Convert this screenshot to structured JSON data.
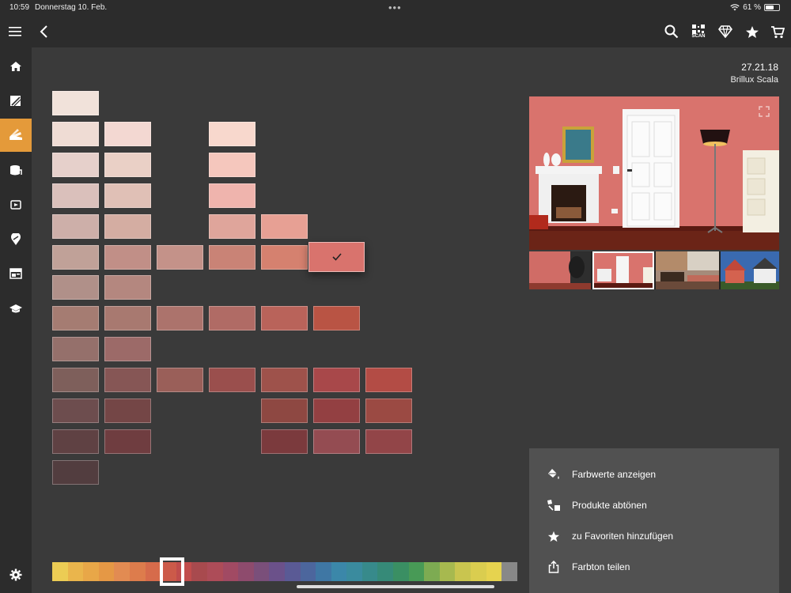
{
  "status_bar": {
    "time": "10:59",
    "date": "Donnerstag 10. Feb.",
    "battery_text": "61 %",
    "battery_level": 0.61,
    "dots": "•••"
  },
  "top_bar": {
    "scan_label": "SCAN",
    "icons": [
      "menu-icon",
      "back-icon",
      "search-icon",
      "qr-scan-icon",
      "diamond-icon",
      "star-icon",
      "cart-icon"
    ]
  },
  "sidebar": {
    "items": [
      "home-icon",
      "wall-paint-icon",
      "color-fan-icon",
      "paint-bucket-icon",
      "video-icon",
      "location-pin-icon",
      "dashboard-icon",
      "education-icon"
    ],
    "active_index": 2,
    "accent": "#e49a3a",
    "settings_icon": "gear-icon"
  },
  "color": {
    "code": "27.21.18",
    "product": "Brillux Scala",
    "selected_hex": "#d9736d"
  },
  "menu": {
    "items": [
      {
        "label": "Farbwerte anzeigen",
        "icon": "paint-bucket-icon"
      },
      {
        "label": "Produkte abtönen",
        "icon": "tint-icon"
      },
      {
        "label": "zu Favoriten hinzufügen",
        "icon": "star-icon"
      },
      {
        "label": "Farbton teilen",
        "icon": "share-icon"
      }
    ]
  },
  "swatch_grid": {
    "selected": {
      "row": 5,
      "col": 5
    },
    "cells": [
      {
        "row": 0,
        "col": 0,
        "color": "#f1e2da"
      },
      {
        "row": 1,
        "col": 0,
        "color": "#efdcd4"
      },
      {
        "row": 1,
        "col": 1,
        "color": "#f3d8d2"
      },
      {
        "row": 1,
        "col": 3,
        "color": "#f8d8cd"
      },
      {
        "row": 2,
        "col": 0,
        "color": "#e6d0cb"
      },
      {
        "row": 2,
        "col": 1,
        "color": "#ead0c6"
      },
      {
        "row": 2,
        "col": 3,
        "color": "#f5c7bd"
      },
      {
        "row": 3,
        "col": 0,
        "color": "#dac0bb"
      },
      {
        "row": 3,
        "col": 1,
        "color": "#e0c0b6"
      },
      {
        "row": 3,
        "col": 3,
        "color": "#efb4ad"
      },
      {
        "row": 4,
        "col": 0,
        "color": "#cdafa9"
      },
      {
        "row": 4,
        "col": 1,
        "color": "#d4ada2"
      },
      {
        "row": 4,
        "col": 3,
        "color": "#dfa59b"
      },
      {
        "row": 4,
        "col": 4,
        "color": "#e7a094"
      },
      {
        "row": 5,
        "col": 0,
        "color": "#c0a198"
      },
      {
        "row": 5,
        "col": 1,
        "color": "#c18f87"
      },
      {
        "row": 5,
        "col": 2,
        "color": "#c49289"
      },
      {
        "row": 5,
        "col": 3,
        "color": "#c98376"
      },
      {
        "row": 5,
        "col": 4,
        "color": "#d5816f"
      },
      {
        "row": 5,
        "col": 5,
        "color": "#d9736d"
      },
      {
        "row": 6,
        "col": 0,
        "color": "#b09089"
      },
      {
        "row": 6,
        "col": 1,
        "color": "#b4877f"
      },
      {
        "row": 7,
        "col": 0,
        "color": "#a57c72"
      },
      {
        "row": 7,
        "col": 1,
        "color": "#a87970"
      },
      {
        "row": 7,
        "col": 2,
        "color": "#ac736c"
      },
      {
        "row": 7,
        "col": 3,
        "color": "#b06b65"
      },
      {
        "row": 7,
        "col": 4,
        "color": "#b9635a"
      },
      {
        "row": 7,
        "col": 5,
        "color": "#b95444"
      },
      {
        "row": 8,
        "col": 0,
        "color": "#95706b"
      },
      {
        "row": 8,
        "col": 1,
        "color": "#9c6a68"
      },
      {
        "row": 9,
        "col": 0,
        "color": "#7e5f5b"
      },
      {
        "row": 9,
        "col": 1,
        "color": "#865655"
      },
      {
        "row": 9,
        "col": 2,
        "color": "#9a5f59"
      },
      {
        "row": 9,
        "col": 3,
        "color": "#9a4f4d"
      },
      {
        "row": 9,
        "col": 4,
        "color": "#9e524b"
      },
      {
        "row": 9,
        "col": 5,
        "color": "#a8484a"
      },
      {
        "row": 9,
        "col": 6,
        "color": "#b34c45"
      },
      {
        "row": 10,
        "col": 0,
        "color": "#6d4d4e"
      },
      {
        "row": 10,
        "col": 1,
        "color": "#744646"
      },
      {
        "row": 10,
        "col": 4,
        "color": "#8e4842"
      },
      {
        "row": 10,
        "col": 5,
        "color": "#934042"
      },
      {
        "row": 10,
        "col": 6,
        "color": "#9b4a43"
      },
      {
        "row": 11,
        "col": 0,
        "color": "#5f4143"
      },
      {
        "row": 11,
        "col": 1,
        "color": "#6f3d40"
      },
      {
        "row": 11,
        "col": 4,
        "color": "#7b3a3d"
      },
      {
        "row": 11,
        "col": 5,
        "color": "#944c52"
      },
      {
        "row": 11,
        "col": 6,
        "color": "#924548"
      },
      {
        "row": 12,
        "col": 0,
        "color": "#523d3f"
      }
    ]
  },
  "palette": {
    "selected_index": 9,
    "colors": [
      "#eccc54",
      "#eab54c",
      "#e8a748",
      "#e59845",
      "#e28b52",
      "#dd7c4c",
      "#d66b4b",
      "#cc5a49",
      "#c14d4c",
      "#a84a4e",
      "#ad4c58",
      "#a14a63",
      "#8e4b6d",
      "#7a4f7a",
      "#6b518a",
      "#5a5a95",
      "#4c669d",
      "#3f77a4",
      "#3b87a9",
      "#3a8b9e",
      "#378a8b",
      "#368a78",
      "#3a8f63",
      "#489a56",
      "#7dab52",
      "#a7b94f",
      "#c9c54f",
      "#dacd4f",
      "#e6d34f",
      "#888888"
    ]
  },
  "scene": {
    "wall_color": "#d9736d",
    "thumbnails": [
      "room-wall-thumbnail",
      "room-door-thumbnail",
      "living-room-thumbnail",
      "house-exterior-thumbnail",
      "house-dark-thumbnail"
    ],
    "selected_thumbnail": 1
  }
}
